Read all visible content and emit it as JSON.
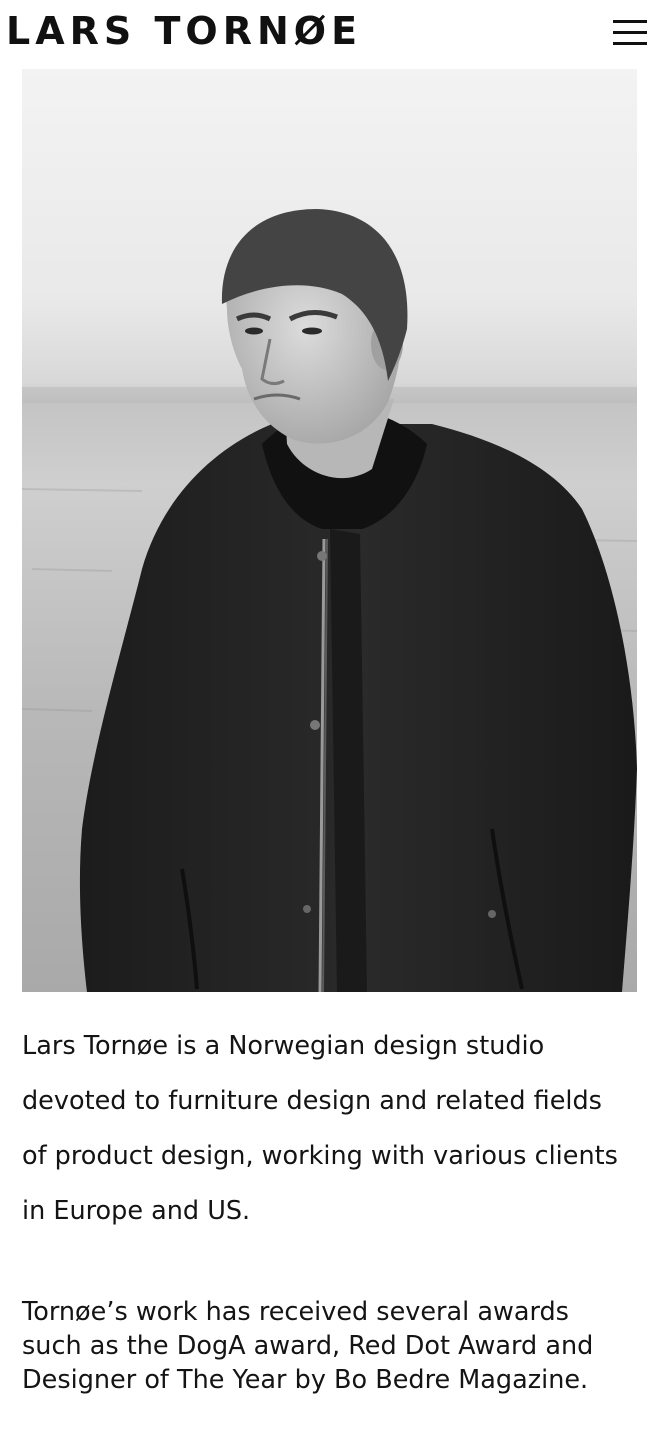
{
  "header": {
    "logo_text": "LARS TORNØE",
    "menu_icon": "hamburger-menu-icon"
  },
  "hero": {
    "description": "Black and white portrait of a man in a knit beanie and dark bomber jacket standing in front of a body of water"
  },
  "main": {
    "intro_text": "Lars Tornøe is a Norwegian design studio devoted to furniture design and related fields of product design, working with various clients in Europe and US.",
    "awards_text": "Tornøe’s work has received several awards such as the DogA award, Red Dot Award and Designer of The Year by Bo Bedre Magazine."
  },
  "colors": {
    "text": "#141414",
    "background": "#ffffff"
  }
}
